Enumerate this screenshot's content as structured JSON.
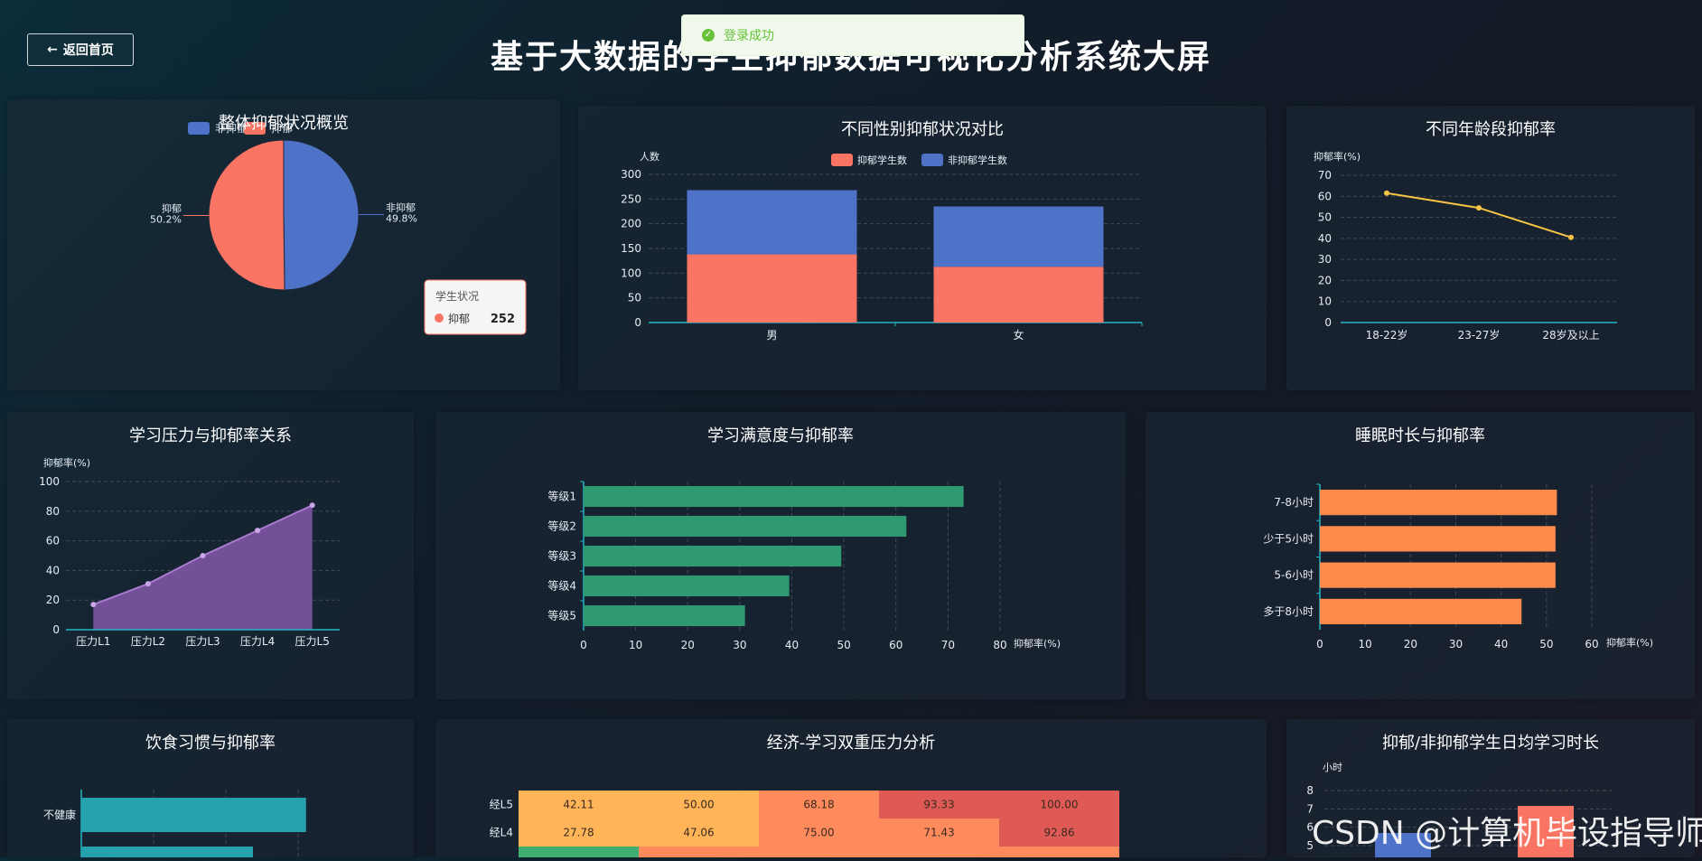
{
  "header": {
    "back_label": "返回首页",
    "title": "基于大数据的学生抑郁数据可视化分析系统大屏"
  },
  "toast": {
    "text": "登录成功"
  },
  "tooltip": {
    "title": "学生状况",
    "label": "抑郁",
    "value": "252"
  },
  "watermark": "CSDN @计算机毕设指导师",
  "colors": {
    "blue": "#4f72c9",
    "red": "#fa7463",
    "green": "#2f9a72",
    "orange": "#fd8b4b",
    "purple": "#7e55a3",
    "gold": "#f6c445",
    "teal": "#25a2ad"
  },
  "chart_data": [
    {
      "id": "overview",
      "type": "pie",
      "title": "整体抑郁状况概览",
      "legend": [
        "非抑郁",
        "抑郁"
      ],
      "slices": [
        {
          "name": "非抑郁",
          "percent": 49.8,
          "label": "49.8%"
        },
        {
          "name": "抑郁",
          "percent": 50.2,
          "label": "50.2%"
        }
      ]
    },
    {
      "id": "gender",
      "type": "bar",
      "title": "不同性别抑郁状况对比",
      "ylabel": "人数",
      "categories": [
        "男",
        "女"
      ],
      "ylim": [
        0,
        300
      ],
      "yticks": [
        0,
        50,
        100,
        150,
        200,
        250,
        300
      ],
      "series": [
        {
          "name": "抑郁学生数",
          "values": [
            138,
            113
          ]
        },
        {
          "name": "非抑郁学生数",
          "values": [
            130,
            122
          ]
        }
      ]
    },
    {
      "id": "age",
      "type": "line",
      "title": "不同年龄段抑郁率",
      "ylabel": "抑郁率(%)",
      "categories": [
        "18-22岁",
        "23-27岁",
        "28岁及以上"
      ],
      "ylim": [
        0,
        70
      ],
      "yticks": [
        0,
        10,
        20,
        30,
        40,
        50,
        60,
        70
      ],
      "values": [
        61.5,
        54.5,
        40.5
      ]
    },
    {
      "id": "pressure",
      "type": "area",
      "title": "学习压力与抑郁率关系",
      "ylabel": "抑郁率(%)",
      "categories": [
        "压力L1",
        "压力L2",
        "压力L3",
        "压力L4",
        "压力L5"
      ],
      "ylim": [
        0,
        100
      ],
      "yticks": [
        0,
        20,
        40,
        60,
        80,
        100
      ],
      "values": [
        17,
        31,
        50,
        67,
        84
      ]
    },
    {
      "id": "satisfaction",
      "type": "bar",
      "title": "学习满意度与抑郁率",
      "xlabel": "抑郁率(%)",
      "categories": [
        "等级1",
        "等级2",
        "等级3",
        "等级4",
        "等级5"
      ],
      "xlim": [
        0,
        80
      ],
      "xticks": [
        0,
        10,
        20,
        30,
        40,
        50,
        60,
        70,
        80
      ],
      "values": [
        73,
        62,
        49.5,
        39.5,
        31
      ]
    },
    {
      "id": "sleep",
      "type": "bar",
      "title": "睡眠时长与抑郁率",
      "xlabel": "抑郁率(%)",
      "categories": [
        "7-8小时",
        "少于5小时",
        "5-6小时",
        "多于8小时"
      ],
      "xlim": [
        0,
        60
      ],
      "xticks": [
        0,
        10,
        20,
        30,
        40,
        50,
        60
      ],
      "values": [
        52.3,
        52,
        52,
        44.5
      ]
    },
    {
      "id": "diet",
      "type": "bar",
      "title": "饮食习惯与抑郁率",
      "categories": [
        "不健康"
      ],
      "values": [
        66
      ]
    },
    {
      "id": "economic",
      "type": "heatmap",
      "title": "经济-学习双重压力分析",
      "rows": [
        {
          "label": "经L5",
          "cells": [
            "42.11",
            "50.00",
            "68.18",
            "93.33",
            "100.00"
          ]
        },
        {
          "label": "经L4",
          "cells": [
            "27.78",
            "47.06",
            "75.00",
            "71.43",
            "92.86"
          ]
        }
      ]
    },
    {
      "id": "study_time",
      "type": "bar",
      "title": "抑郁/非抑郁学生日均学习时长",
      "ylabel": "小时",
      "yticks": [
        5,
        6,
        7,
        8
      ]
    }
  ]
}
